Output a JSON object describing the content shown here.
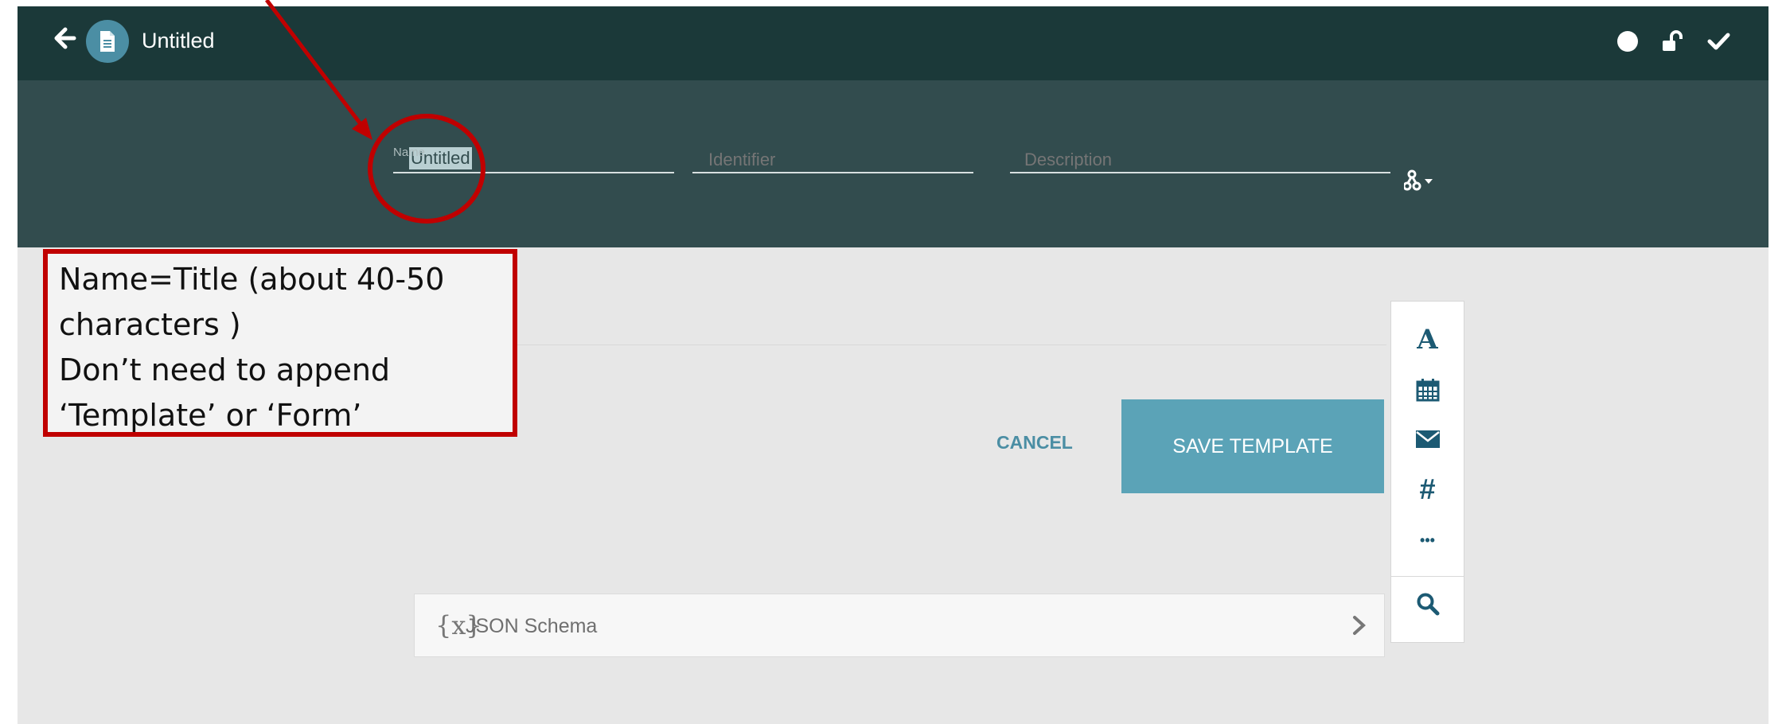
{
  "topbar": {
    "title": "Untitled"
  },
  "fields": {
    "name_label": "Name",
    "name_value": "Untitled",
    "identifier_placeholder": "Identifier",
    "description_placeholder": "Description"
  },
  "actions": {
    "cancel_label": "CANCEL",
    "save_label": "SAVE TEMPLATE"
  },
  "palette": {
    "text_glyph": "A",
    "number_glyph": "#",
    "more_glyph": "•••"
  },
  "json_panel": {
    "icon_glyph": "{x}",
    "label": "JSON Schema"
  },
  "annotation": {
    "lines": [
      "Name=Title (about 40-50",
      "characters )",
      "Don’t need to append",
      "‘Template’ or ‘Form’"
    ]
  },
  "colors": {
    "topbar": "#1b3939",
    "header": "#324c4e",
    "accent": "#5ba3b7",
    "annotation_red": "#c00000"
  }
}
